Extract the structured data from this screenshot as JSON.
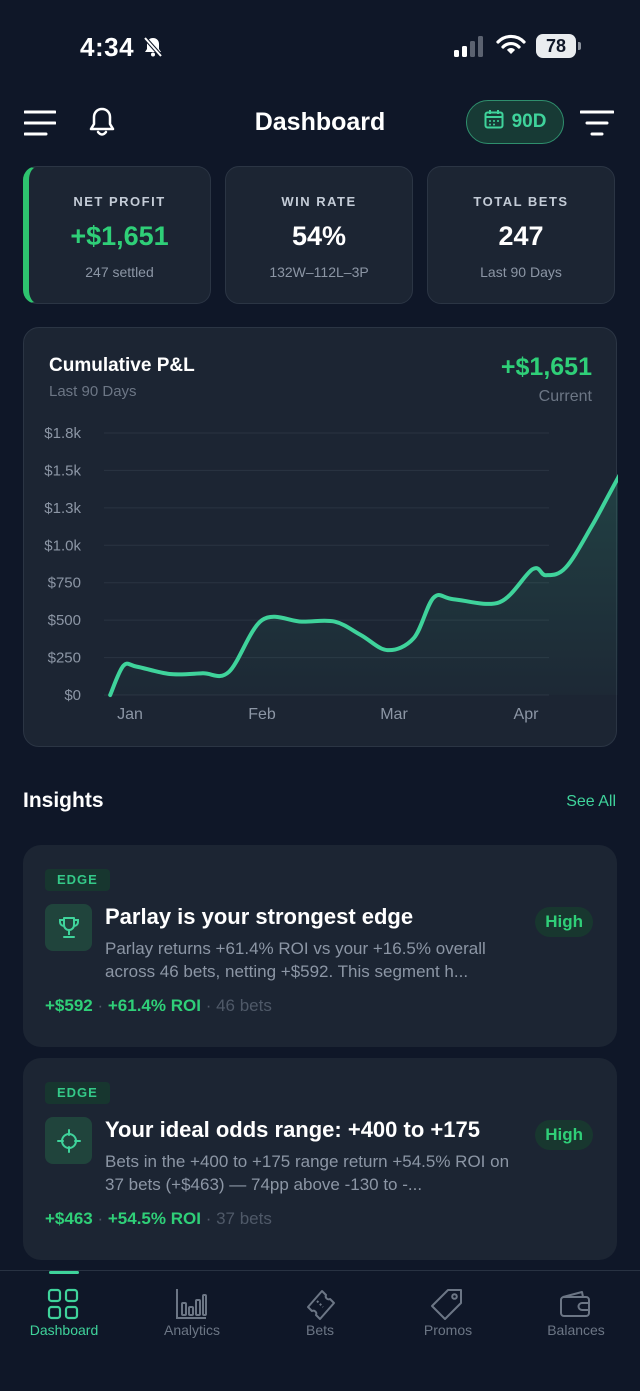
{
  "status": {
    "time": "4:34",
    "battery": "78",
    "icons": [
      "bell-slash-icon",
      "signal-icon",
      "wifi-icon",
      "battery-icon"
    ]
  },
  "header": {
    "title": "Dashboard",
    "range": "90D",
    "icons": [
      "menu-icon",
      "bell-icon",
      "calendar-icon",
      "filter-icon"
    ]
  },
  "stats": [
    {
      "label": "NET PROFIT",
      "value": "+$1,651",
      "sub": "247 settled"
    },
    {
      "label": "WIN RATE",
      "value": "54%",
      "sub": "132W–112L–3P"
    },
    {
      "label": "TOTAL BETS",
      "value": "247",
      "sub": "Last 90 Days"
    }
  ],
  "colors": {
    "background": "#0f1728",
    "card": "#1c2533",
    "accent": "#3fd39b",
    "positive": "#2fcf78"
  },
  "chart": {
    "title": "Cumulative P&L",
    "subtitle": "Last 90 Days",
    "value": "+$1,651",
    "value_label": "Current"
  },
  "chart_data": {
    "type": "area",
    "title": "Cumulative P&L",
    "subtitle": "Last 90 Days",
    "xlabel": "",
    "ylabel": "",
    "x_ticks": [
      "Jan",
      "Feb",
      "Mar",
      "Apr"
    ],
    "y_ticks": [
      "$0",
      "$250",
      "$500",
      "$750",
      "$1.0k",
      "$1.3k",
      "$1.5k",
      "$1.8k"
    ],
    "ylim": [
      0,
      1750
    ],
    "grid": true,
    "legend": "none",
    "x": [
      -0.15,
      -0.05,
      0.05,
      0.3,
      0.55,
      0.75,
      1.0,
      1.3,
      1.55,
      1.75,
      1.95,
      2.15,
      2.3,
      2.45,
      2.8,
      3.05,
      3.15,
      3.3,
      3.5,
      3.75,
      3.9,
      4.0
    ],
    "values": [
      0,
      195,
      190,
      140,
      145,
      155,
      500,
      490,
      490,
      400,
      300,
      380,
      650,
      640,
      620,
      840,
      800,
      850,
      1130,
      1530,
      1680,
      1655
    ]
  },
  "insights": {
    "title": "Insights",
    "see_all": "See All",
    "items": [
      {
        "badge": "EDGE",
        "icon": "trophy-icon",
        "heading": "Parlay is your strongest edge",
        "description": "Parlay returns +61.4% ROI vs your +16.5% overall across 46 bets, netting +$592. This segment h...",
        "priority": "High",
        "profit": "+$592",
        "roi": "+61.4% ROI",
        "bets": "46 bets"
      },
      {
        "badge": "EDGE",
        "icon": "target-icon",
        "heading": "Your ideal odds range: +400 to +175",
        "description": "Bets in the +400 to +175 range return +54.5% ROI on 37 bets (+$463) — 74pp above -130 to -...",
        "priority": "High",
        "profit": "+$463",
        "roi": "+54.5% ROI",
        "bets": "37 bets"
      }
    ]
  },
  "tabs": [
    {
      "label": "Dashboard",
      "icon": "grid-icon",
      "active": true
    },
    {
      "label": "Analytics",
      "icon": "bar-chart-icon",
      "active": false
    },
    {
      "label": "Bets",
      "icon": "ticket-icon",
      "active": false
    },
    {
      "label": "Promos",
      "icon": "tag-icon",
      "active": false
    },
    {
      "label": "Balances",
      "icon": "wallet-icon",
      "active": false
    }
  ]
}
